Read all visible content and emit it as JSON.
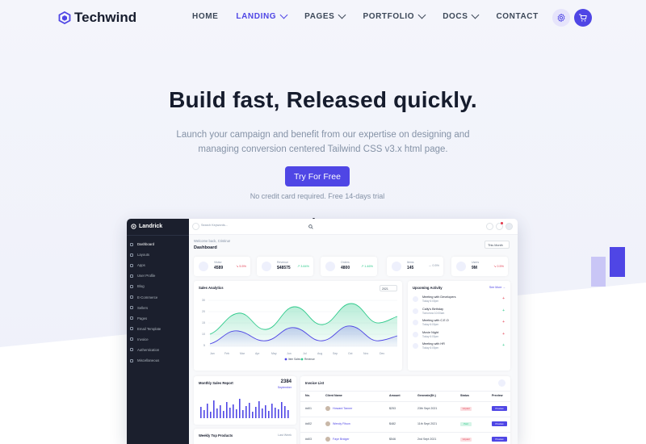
{
  "brand": {
    "name": "Techwind",
    "accent": "#4f46e5"
  },
  "nav": {
    "items": [
      {
        "label": "HOME",
        "dropdown": false,
        "active": false
      },
      {
        "label": "LANDING",
        "dropdown": true,
        "active": true
      },
      {
        "label": "PAGES",
        "dropdown": true,
        "active": false
      },
      {
        "label": "PORTFOLIO",
        "dropdown": true,
        "active": false
      },
      {
        "label": "DOCS",
        "dropdown": true,
        "active": false
      },
      {
        "label": "CONTACT",
        "dropdown": false,
        "active": false
      }
    ],
    "settings_icon": "gear-icon",
    "cart_icon": "cart-icon"
  },
  "hero": {
    "title": "Build fast, Released quickly.",
    "subtitle_line1": "Launch your campaign and benefit from our expertise on designing and",
    "subtitle_line2": "managing conversion centered Tailwind CSS v3.x html page.",
    "cta_label": "Try For Free",
    "note": "No credit card required. Free 14-days trial"
  },
  "dashboard": {
    "brand": "Landrick",
    "search_placeholder": "Search Keywords...",
    "sidebar": [
      "Dashboard",
      "Layouts",
      "Apps",
      "User Profile",
      "Blog",
      "E-Commerce",
      "Sellers",
      "Pages",
      "Email Template",
      "Invoice",
      "Authentication",
      "Miscellaneous"
    ],
    "welcome": "Welcome back, Cristina!",
    "title": "Dashboard",
    "month_select": "This Month",
    "stats": [
      {
        "label": "Visitor",
        "value": "4589",
        "pct": "5.5%",
        "trend": "down"
      },
      {
        "label": "Revenue",
        "value": "$48575",
        "pct": "3.84%",
        "trend": "up"
      },
      {
        "label": "Orders",
        "value": "4800",
        "pct": "1.46%",
        "trend": "up"
      },
      {
        "label": "Items",
        "value": "145",
        "pct": "0.5%",
        "trend": "flat"
      },
      {
        "label": "Users",
        "value": "9M",
        "pct": "0.5%",
        "trend": "down"
      }
    ],
    "sales_analytics": {
      "title": "Sales Analytics",
      "year": "2021",
      "legend": [
        "Item Sales",
        "Revenue"
      ]
    },
    "activity": {
      "title": "Upcoming Activity",
      "see_more": "See More",
      "items": [
        {
          "title": "Meeting with Developers",
          "time": "Today 6:00pm",
          "color": "#e43f52"
        },
        {
          "title": "Cally's Birthday",
          "time": "Tomorrow 10:00am",
          "color": "#2eca8b"
        },
        {
          "title": "Meeting with C.E.O",
          "time": "Today 6:00pm",
          "color": "#e43f52"
        },
        {
          "title": "Movie Night",
          "time": "Today 6:00pm",
          "color": "#e43f52"
        },
        {
          "title": "Meeting with HR",
          "time": "Today 6:00pm",
          "color": "#2eca8b"
        }
      ]
    },
    "monthly_sales": {
      "title": "Monthly Sales Report",
      "value": "2384",
      "period": "September"
    },
    "weekly_products": {
      "title": "Weekly Top Products",
      "period": "Last Week"
    },
    "invoice": {
      "title": "Invoice List",
      "headers": [
        "No.",
        "Client Name",
        "Amount",
        "Generate(Dt.)",
        "Status",
        "Preview"
      ],
      "rows": [
        {
          "no": "#d01",
          "name": "Howard Tanner",
          "amount": "$253",
          "date": "23th Sept 2021",
          "status": "Unpaid",
          "preview": "Preview"
        },
        {
          "no": "#d02",
          "name": "Wendy Filson",
          "amount": "$482",
          "date": "11th Sept 2021",
          "status": "Paid",
          "preview": "Preview"
        },
        {
          "no": "#d03",
          "name": "Faye Bridger",
          "amount": "$546",
          "date": "2nd Sept 2021",
          "status": "Unpaid",
          "preview": "Preview"
        }
      ]
    }
  }
}
